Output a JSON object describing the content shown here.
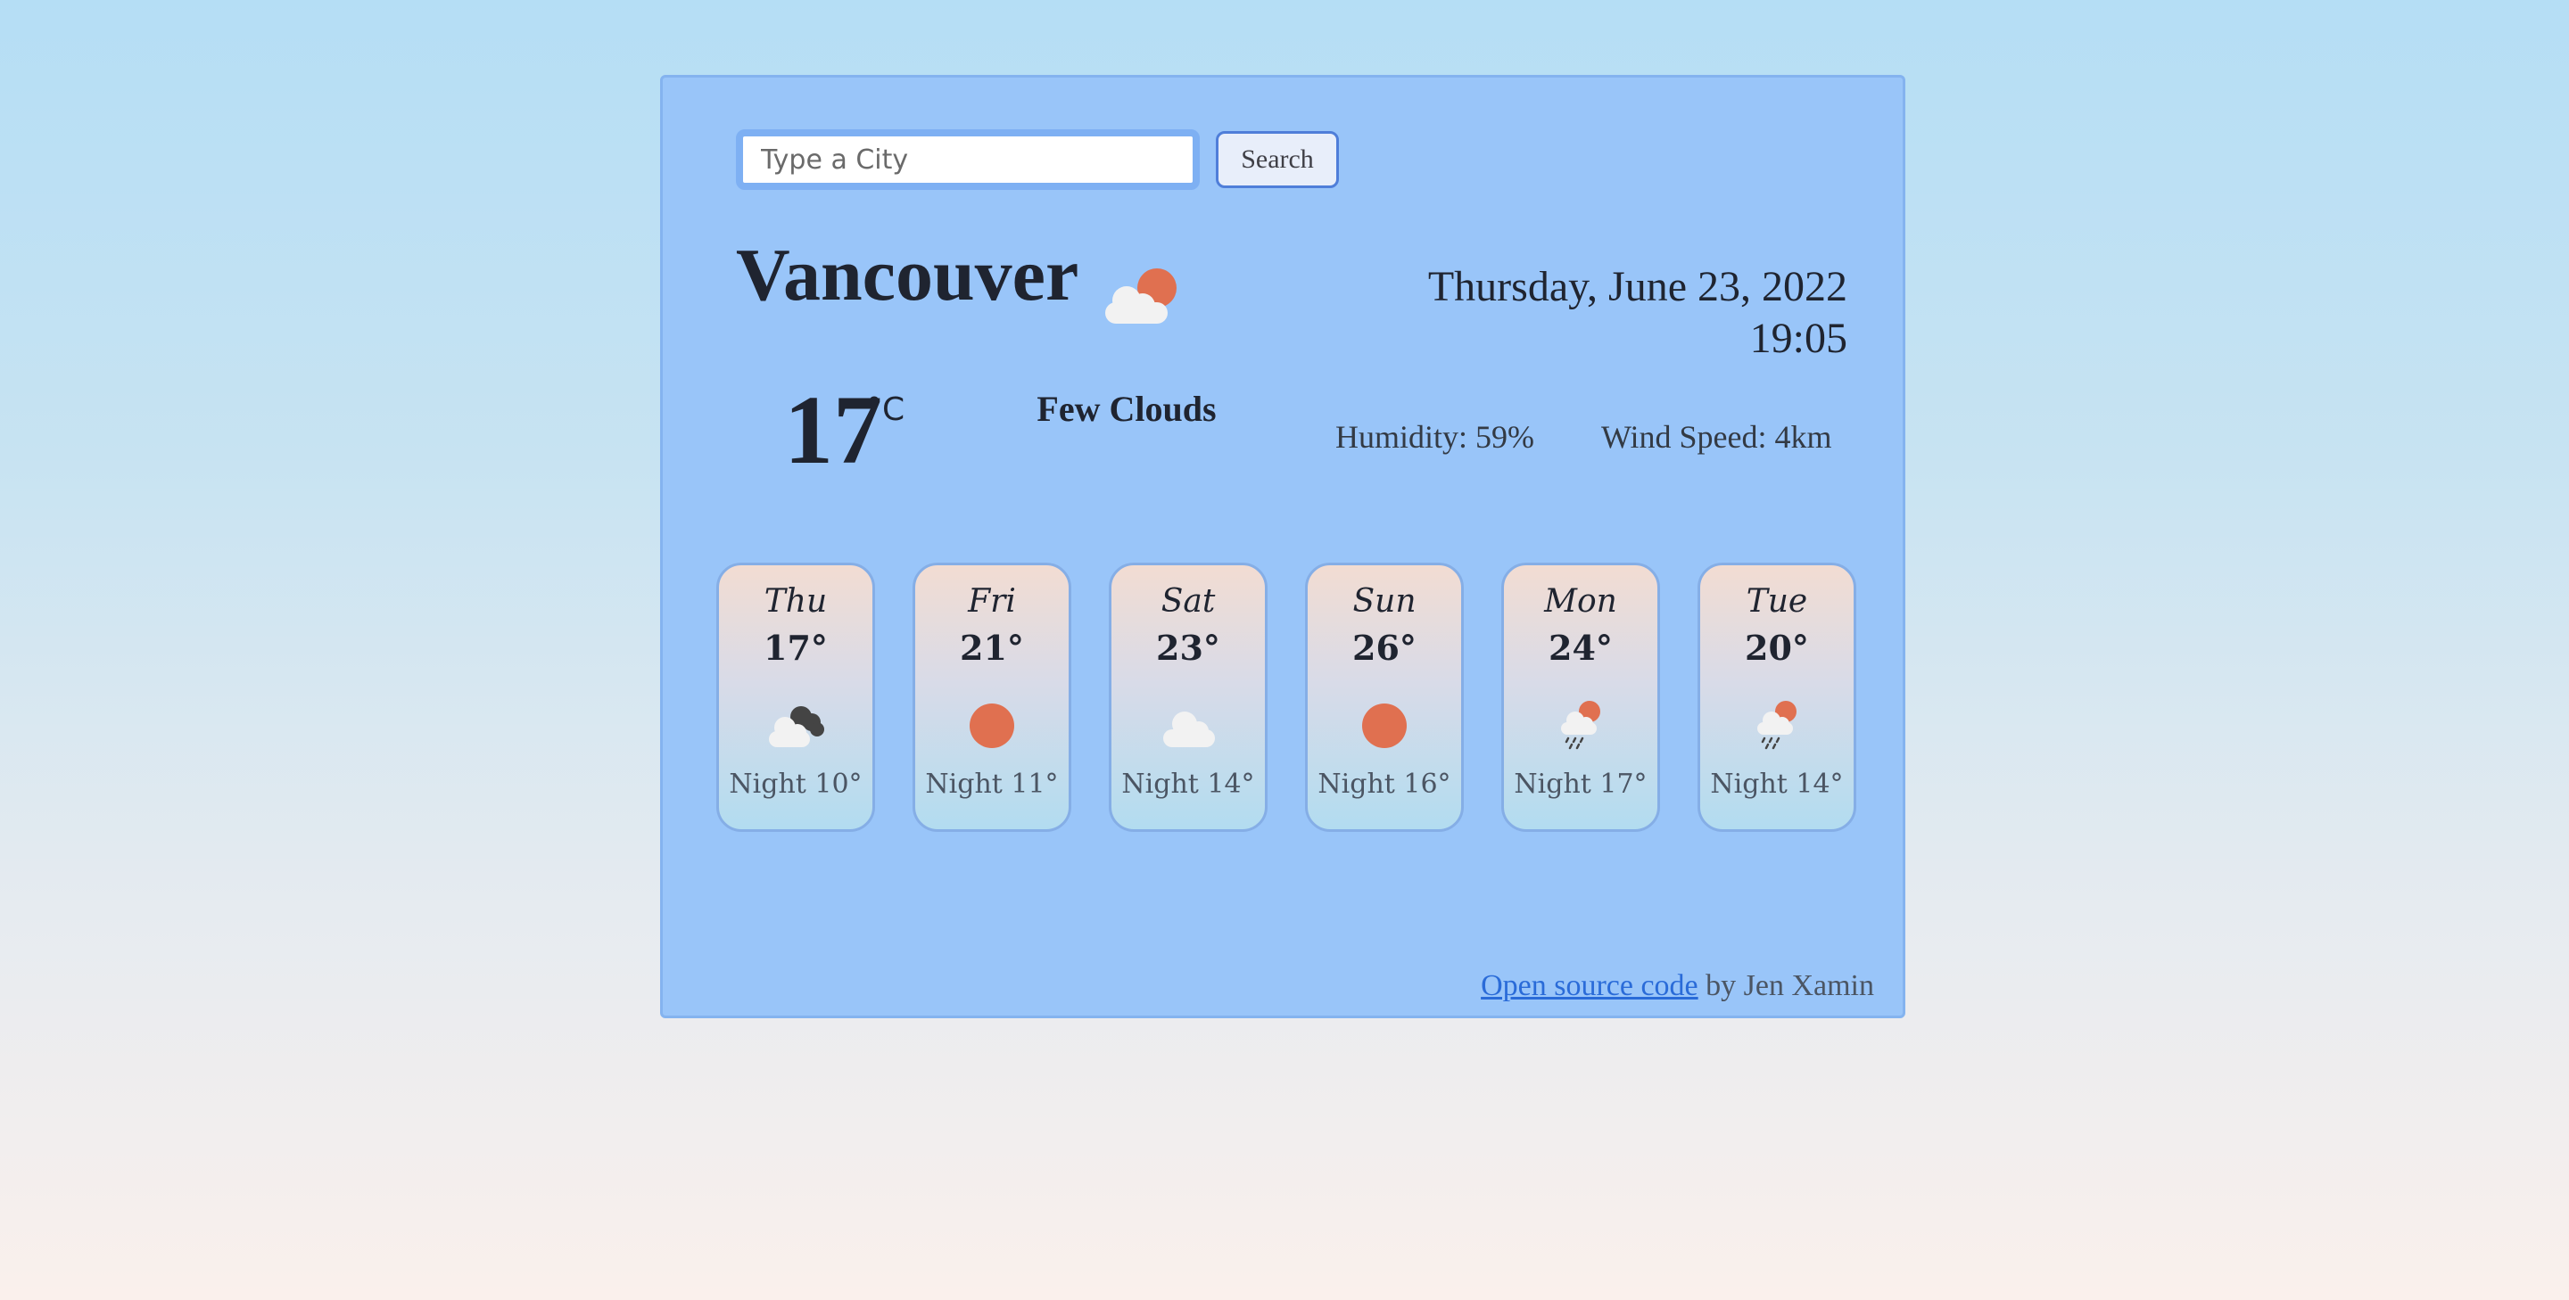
{
  "search": {
    "placeholder": "Type a City",
    "value": "",
    "button_label": "Search"
  },
  "current": {
    "city": "Vancouver",
    "icon": "few-clouds-day-icon",
    "date": "Thursday, June 23, 2022",
    "time": "19:05",
    "temperature": "17",
    "unit": "°C",
    "description": "Few Clouds",
    "humidity": "Humidity: 59%",
    "wind": "Wind Speed: 4km"
  },
  "forecast": [
    {
      "day": "Thu",
      "temp": "17°",
      "night": "Night 10°",
      "icon": "broken-clouds-icon"
    },
    {
      "day": "Fri",
      "temp": "21°",
      "night": "Night 11°",
      "icon": "sun-icon"
    },
    {
      "day": "Sat",
      "temp": "23°",
      "night": "Night 14°",
      "icon": "cloud-icon"
    },
    {
      "day": "Sun",
      "temp": "26°",
      "night": "Night 16°",
      "icon": "sun-icon"
    },
    {
      "day": "Mon",
      "temp": "24°",
      "night": "Night 17°",
      "icon": "rain-sun-icon"
    },
    {
      "day": "Tue",
      "temp": "20°",
      "night": "Night 14°",
      "icon": "rain-sun-icon"
    }
  ],
  "footer": {
    "link_label": "Open source code",
    "suffix": " by Jen Xamin"
  },
  "colors": {
    "sun": "#e07050",
    "cloud": "#f2f2f2",
    "dark_cloud": "#444444",
    "link": "#2a6bd8",
    "panel": "#99c5f9"
  }
}
